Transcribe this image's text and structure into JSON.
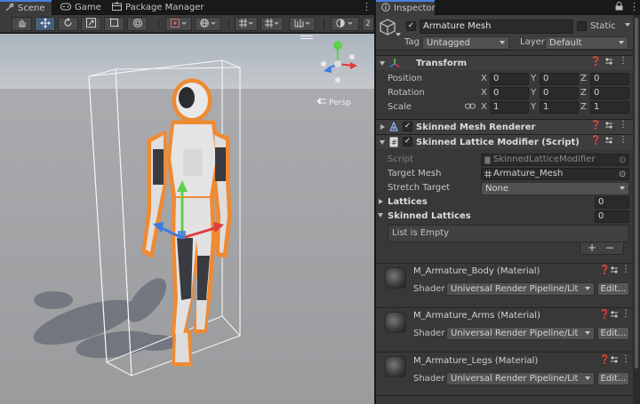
{
  "scene_tabs": [
    {
      "label": "Scene",
      "active": true
    },
    {
      "label": "Game",
      "active": false
    },
    {
      "label": "Package Manager",
      "active": false
    }
  ],
  "scene_toolbar": {
    "twod_label": "2"
  },
  "gizmo": {
    "persp_label": "Persp"
  },
  "inspector_tab": {
    "label": "Inspector"
  },
  "object": {
    "name": "Armature Mesh",
    "active": true,
    "static_label": "Static",
    "tag_label": "Tag",
    "tag_value": "Untagged",
    "layer_label": "Layer",
    "layer_value": "Default"
  },
  "transform": {
    "title": "Transform",
    "position_label": "Position",
    "rotation_label": "Rotation",
    "scale_label": "Scale",
    "axis_x": "X",
    "axis_y": "Y",
    "axis_z": "Z",
    "position": [
      "0",
      "0",
      "0"
    ],
    "rotation": [
      "0",
      "0",
      "0"
    ],
    "scale": [
      "1",
      "1",
      "1"
    ]
  },
  "skinned_mesh_renderer": {
    "title": "Skinned Mesh Renderer",
    "enabled": true
  },
  "lattice_modifier": {
    "title": "Skinned Lattice Modifier (Script)",
    "enabled": true,
    "script_label": "Script",
    "script_value": "SkinnedLatticeModifier",
    "target_mesh_label": "Target Mesh",
    "target_mesh_value": "Armature_Mesh",
    "stretch_target_label": "Stretch Target",
    "stretch_target_value": "None",
    "lattices_label": "Lattices",
    "lattices_count": "0",
    "skinned_lattices_label": "Skinned Lattices",
    "skinned_lattices_count": "0",
    "list_empty_text": "List is Empty",
    "add_label": "+",
    "remove_label": "−"
  },
  "materials": [
    {
      "name": "M_Armature_Body (Material)",
      "shader_label": "Shader",
      "shader": "Universal Render Pipeline/Lit",
      "edit_label": "Edit..."
    },
    {
      "name": "M_Armature_Arms (Material)",
      "shader_label": "Shader",
      "shader": "Universal Render Pipeline/Lit",
      "edit_label": "Edit..."
    },
    {
      "name": "M_Armature_Legs (Material)",
      "shader_label": "Shader",
      "shader": "Universal Render Pipeline/Lit",
      "edit_label": "Edit..."
    }
  ],
  "colors": {
    "accent": "#4b7ee0",
    "selection_outline": "#f08a32",
    "axis_x": "#e03c3c",
    "axis_y": "#5fd04a",
    "axis_z": "#3c7be0"
  }
}
